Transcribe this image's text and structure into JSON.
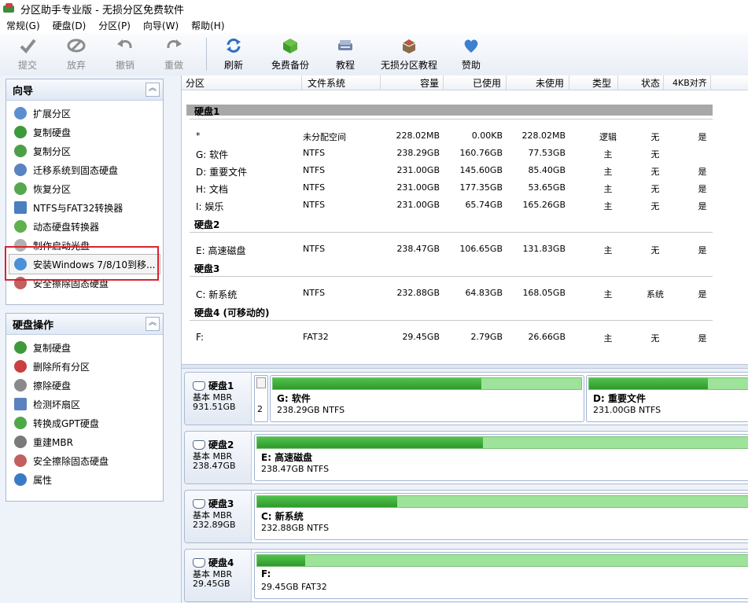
{
  "window": {
    "title": "分区助手专业版 - 无损分区免费软件"
  },
  "menu": [
    "常规(G)",
    "硬盘(D)",
    "分区(P)",
    "向导(W)",
    "帮助(H)"
  ],
  "toolbar": {
    "buttons": [
      {
        "label": "提交",
        "icon": "check-icon",
        "enabled": false
      },
      {
        "label": "放弃",
        "icon": "discard-icon",
        "enabled": false
      },
      {
        "label": "撤销",
        "icon": "undo-icon",
        "enabled": false
      },
      {
        "label": "重做",
        "icon": "redo-icon",
        "enabled": false
      },
      {
        "label": "刷新",
        "icon": "refresh-icon",
        "enabled": true
      },
      {
        "label": "免费备份",
        "icon": "backup-icon",
        "enabled": true
      },
      {
        "label": "教程",
        "icon": "tutorial-icon",
        "enabled": true
      },
      {
        "label": "无损分区教程",
        "icon": "partition-tutorial-icon",
        "enabled": true
      },
      {
        "label": "赞助",
        "icon": "heart-icon",
        "enabled": true
      }
    ]
  },
  "wizard_panel": {
    "title": "向导",
    "items": [
      "扩展分区",
      "复制硬盘",
      "复制分区",
      "迁移系统到固态硬盘",
      "恢复分区",
      "NTFS与FAT32转换器",
      "动态硬盘转换器",
      "制作启动光盘",
      "安装Windows 7/8/10到移...",
      "安全擦除固态硬盘"
    ],
    "selected_index": 8
  },
  "disk_ops_panel": {
    "title": "硬盘操作",
    "items": [
      "复制硬盘",
      "删除所有分区",
      "擦除硬盘",
      "检测坏扇区",
      "转换成GPT硬盘",
      "重建MBR",
      "安全擦除固态硬盘",
      "属性"
    ]
  },
  "columns": [
    "分区",
    "文件系统",
    "容量",
    "已使用",
    "未使用",
    "类型",
    "状态",
    "4KB对齐"
  ],
  "disks_table": [
    {
      "name": "硬盘1",
      "rows": [
        {
          "partition": "*",
          "fs": "未分配空间",
          "capacity": "228.02MB",
          "used": "0.00KB",
          "free": "228.02MB",
          "type": "逻辑",
          "status": "无",
          "align": "是"
        },
        {
          "partition": "G: 软件",
          "fs": "NTFS",
          "capacity": "238.29GB",
          "used": "160.76GB",
          "free": "77.53GB",
          "type": "主",
          "status": "无",
          "align": ""
        },
        {
          "partition": "D: 重要文件",
          "fs": "NTFS",
          "capacity": "231.00GB",
          "used": "145.60GB",
          "free": "85.40GB",
          "type": "主",
          "status": "无",
          "align": "是"
        },
        {
          "partition": "H: 文档",
          "fs": "NTFS",
          "capacity": "231.00GB",
          "used": "177.35GB",
          "free": "53.65GB",
          "type": "主",
          "status": "无",
          "align": "是"
        },
        {
          "partition": "I: 娱乐",
          "fs": "NTFS",
          "capacity": "231.00GB",
          "used": "65.74GB",
          "free": "165.26GB",
          "type": "主",
          "status": "无",
          "align": "是"
        }
      ]
    },
    {
      "name": "硬盘2",
      "rows": [
        {
          "partition": "E: 高速磁盘",
          "fs": "NTFS",
          "capacity": "238.47GB",
          "used": "106.65GB",
          "free": "131.83GB",
          "type": "主",
          "status": "无",
          "align": "是"
        }
      ]
    },
    {
      "name": "硬盘3",
      "rows": [
        {
          "partition": "C: 新系统",
          "fs": "NTFS",
          "capacity": "232.88GB",
          "used": "64.83GB",
          "free": "168.05GB",
          "type": "主",
          "status": "系统",
          "align": "是"
        }
      ]
    },
    {
      "name": "硬盘4 (可移动的)",
      "rows": [
        {
          "partition": "F:",
          "fs": "FAT32",
          "capacity": "29.45GB",
          "used": "2.79GB",
          "free": "26.66GB",
          "type": "主",
          "status": "无",
          "align": "是"
        }
      ]
    }
  ],
  "disk_map": [
    {
      "name": "硬盘1",
      "type": "基本 MBR",
      "size": "931.51GB",
      "unallocated_num": "2",
      "partitions": [
        {
          "label": "G: 软件",
          "info": "238.29GB NTFS",
          "used_fraction": 0.675
        },
        {
          "label": "D: 重要文件",
          "info": "231.00GB NTFS",
          "used_fraction": 0.63
        }
      ]
    },
    {
      "name": "硬盘2",
      "type": "基本 MBR",
      "size": "238.47GB",
      "partitions": [
        {
          "label": "E: 高速磁盘",
          "info": "238.47GB NTFS",
          "used_fraction": 0.447
        }
      ]
    },
    {
      "name": "硬盘3",
      "type": "基本 MBR",
      "size": "232.89GB",
      "partitions": [
        {
          "label": "C: 新系统",
          "info": "232.88GB NTFS",
          "used_fraction": 0.278
        }
      ]
    },
    {
      "name": "硬盘4",
      "type": "基本 MBR",
      "size": "29.45GB",
      "partitions": [
        {
          "label": "F:",
          "info": "29.45GB FAT32",
          "used_fraction": 0.095
        }
      ]
    }
  ],
  "colors": {
    "accent": "#2e9a2b",
    "bar_light": "#9ee39a",
    "highlight": "#d9232e"
  }
}
